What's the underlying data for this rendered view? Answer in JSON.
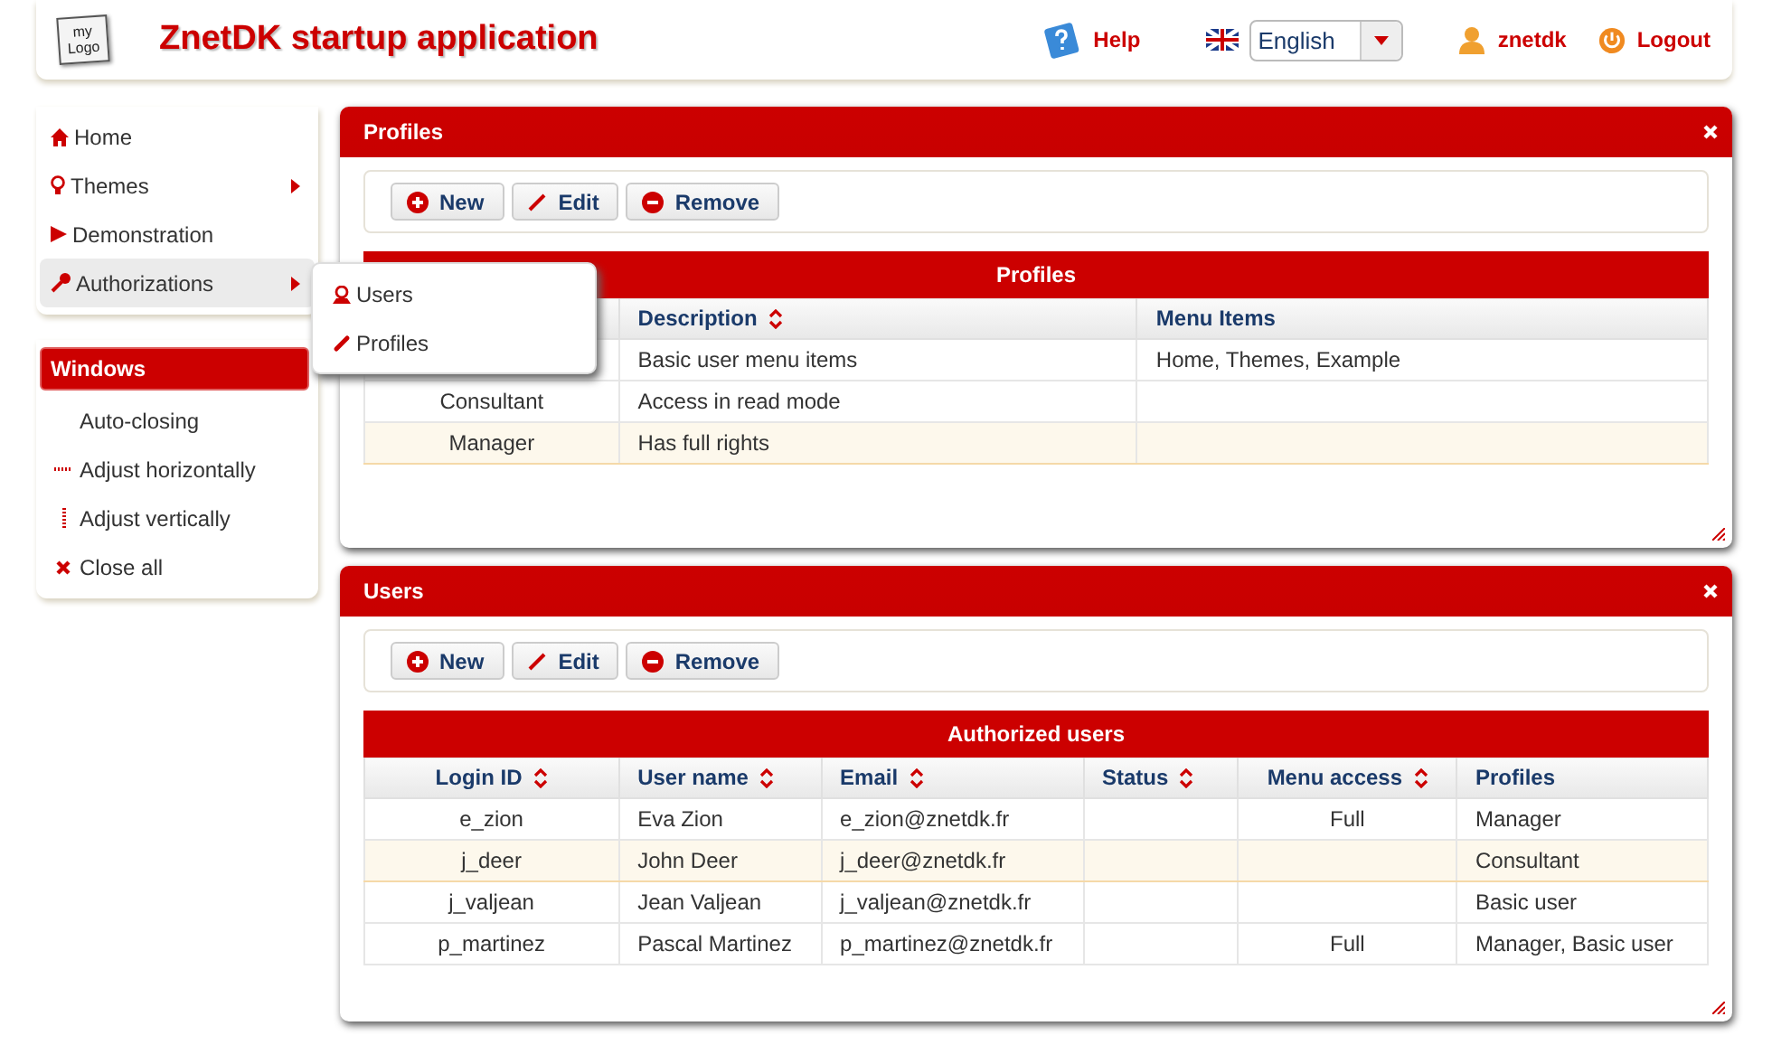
{
  "header": {
    "logo_lines": [
      "my",
      "Logo"
    ],
    "title": "ZnetDK startup application",
    "help": "Help",
    "language": "English",
    "user": "znetdk",
    "logout": "Logout"
  },
  "sidebar": {
    "items": [
      {
        "label": "Home",
        "submenu": false,
        "selected": false
      },
      {
        "label": "Themes",
        "submenu": true,
        "selected": false
      },
      {
        "label": "Demonstration",
        "submenu": false,
        "selected": false
      },
      {
        "label": "Authorizations",
        "submenu": true,
        "selected": true
      }
    ],
    "windows_title": "Windows",
    "windows_items": [
      {
        "label": "Auto-closing"
      },
      {
        "label": "Adjust horizontally"
      },
      {
        "label": "Adjust vertically"
      },
      {
        "label": "Close all"
      }
    ]
  },
  "submenu": {
    "items": [
      {
        "label": "Users"
      },
      {
        "label": "Profiles"
      }
    ]
  },
  "panels": [
    {
      "title": "Profiles",
      "buttons": [
        "New",
        "Edit",
        "Remove"
      ],
      "table_title": "Profiles",
      "columns": [
        {},
        {
          "label": "Description",
          "sortable": true
        },
        {
          "label": "Menu Items",
          "sortable": false
        }
      ],
      "rows": [
        {
          "selected": false,
          "cells": [
            null,
            "Basic user menu items",
            "Home, Themes, Example"
          ]
        },
        {
          "selected": false,
          "cells": [
            "Consultant",
            "Access in read mode",
            null
          ]
        },
        {
          "selected": true,
          "cells": [
            "Manager",
            "Has full rights",
            null
          ]
        }
      ]
    },
    {
      "title": "Users",
      "buttons": [
        "New",
        "Edit",
        "Remove"
      ],
      "table_title": "Authorized users",
      "columns": [
        {
          "label": "Login ID",
          "sortable": true
        },
        {
          "label": "User name",
          "sortable": true
        },
        {
          "label": "Email",
          "sortable": true
        },
        {
          "label": "Status",
          "sortable": true
        },
        {
          "label": "Menu access",
          "sortable": true
        },
        {
          "label": "Profiles",
          "sortable": false
        }
      ],
      "rows": [
        {
          "selected": false,
          "cells": [
            "e_zion",
            "Eva Zion",
            "e_zion@znetdk.fr",
            null,
            "Full",
            "Manager"
          ]
        },
        {
          "selected": true,
          "cells": [
            "j_deer",
            "John Deer",
            "j_deer@znetdk.fr",
            null,
            null,
            "Consultant"
          ]
        },
        {
          "selected": false,
          "cells": [
            "j_valjean",
            "Jean Valjean",
            "j_valjean@znetdk.fr",
            null,
            null,
            "Basic user"
          ]
        },
        {
          "selected": false,
          "cells": [
            "p_martinez",
            "Pascal Martinez",
            "p_martinez@znetdk.fr",
            null,
            "Full",
            "Manager, Basic user"
          ]
        }
      ]
    }
  ]
}
